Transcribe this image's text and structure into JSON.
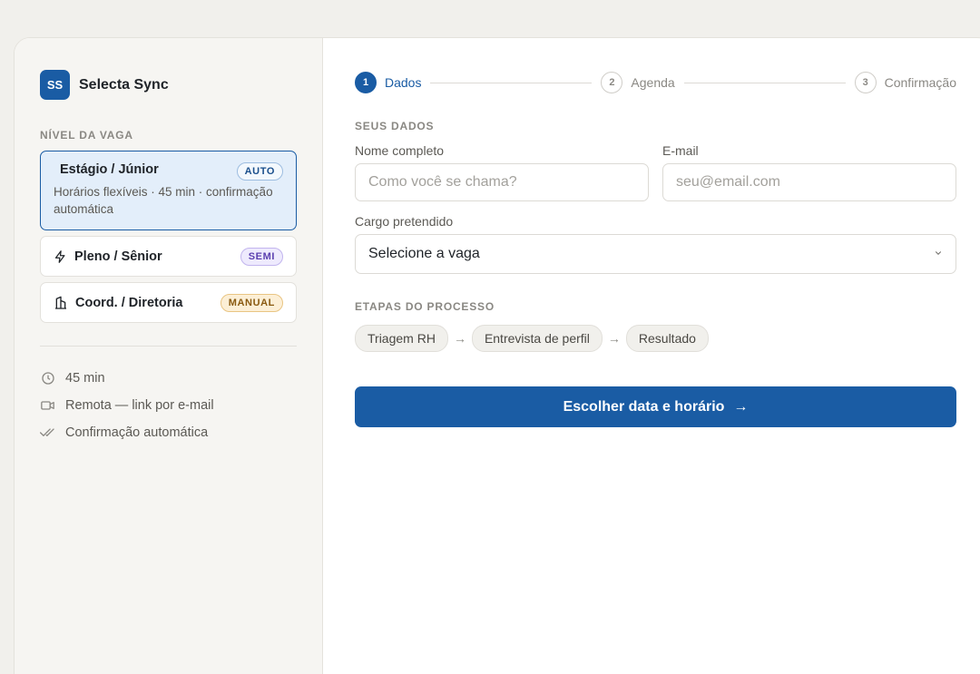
{
  "brand": {
    "initials": "SS",
    "name": "Selecta Sync"
  },
  "sidebar": {
    "section_label": "NÍVEL DA VAGA",
    "levels": [
      {
        "title": "Estágio / Júnior",
        "badge": "AUTO",
        "description": "Horários flexíveis · 45 min · confirmação automática",
        "icon": "none",
        "active": true
      },
      {
        "title": "Pleno / Sênior",
        "badge": "SEMI",
        "icon": "lightning-icon"
      },
      {
        "title": "Coord. / Diretoria",
        "badge": "MANUAL",
        "icon": "building-icon"
      }
    ],
    "meta": [
      {
        "icon": "clock-icon",
        "text": "45 min"
      },
      {
        "icon": "video-icon",
        "text": "Remota — link por e-mail"
      },
      {
        "icon": "double-check-icon",
        "text": "Confirmação automática"
      }
    ]
  },
  "stepper": {
    "steps": [
      {
        "number": "1",
        "label": "Dados",
        "active": true
      },
      {
        "number": "2",
        "label": "Agenda"
      },
      {
        "number": "3",
        "label": "Confirmação"
      }
    ]
  },
  "form": {
    "section_label": "SEUS DADOS",
    "name_label": "Nome completo",
    "name_placeholder": "Como você se chama?",
    "name_value": "",
    "email_label": "E-mail",
    "email_placeholder": "seu@email.com",
    "email_value": "",
    "role_label": "Cargo pretendido",
    "role_selected": "Selecione a vaga"
  },
  "process": {
    "section_label": "ETAPAS DO PROCESSO",
    "stages": [
      "Triagem RH",
      "Entrevista de perfil",
      "Resultado"
    ],
    "separator": "→"
  },
  "cta": {
    "label": "Escolher data e horário",
    "icon": "→"
  },
  "colors": {
    "accent": "#1a5ca4",
    "background": "#f1f0ec",
    "sidebar": "#f6f5f2"
  }
}
